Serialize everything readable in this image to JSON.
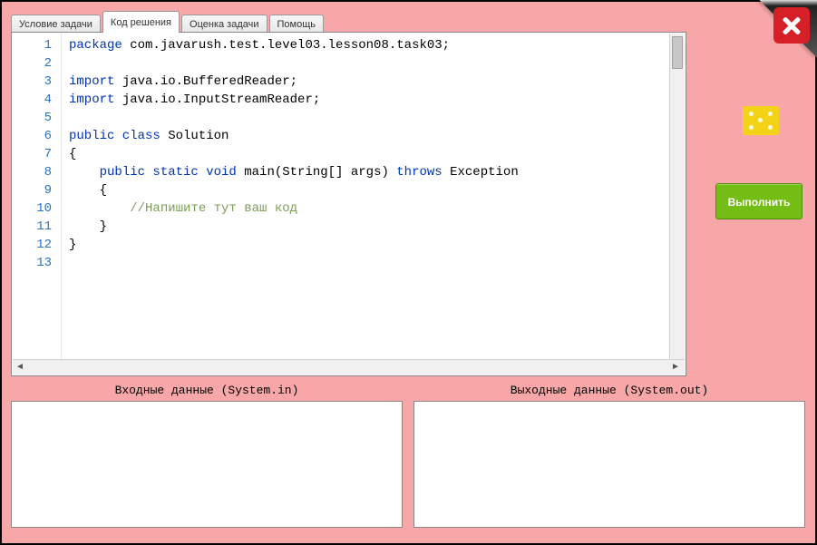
{
  "tabs": {
    "items": [
      {
        "label": "Условие задачи"
      },
      {
        "label": "Код решения"
      },
      {
        "label": "Оценка задачи"
      },
      {
        "label": "Помощь"
      }
    ],
    "active_index": 1
  },
  "editor": {
    "line_count": 13,
    "lines": {
      "l1_kw": "package",
      "l1_rest": " com.javarush.test.level03.lesson08.task03;",
      "l2": "",
      "l3_kw": "import",
      "l3_rest": " java.io.BufferedReader;",
      "l4_kw": "import",
      "l4_rest": " java.io.InputStreamReader;",
      "l5": "",
      "l6_kw": "public class",
      "l6_rest": " Solution",
      "l7": "{",
      "l8_pad": "    ",
      "l8_kw": "public static void",
      "l8_mid": " main(String[] args) ",
      "l8_kw2": "throws",
      "l8_rest": " Exception",
      "l9": "    {",
      "l10_pad": "        ",
      "l10_comment": "//Напишите тут ваш код",
      "l11": "    }",
      "l12": "}",
      "l13": ""
    }
  },
  "io": {
    "input_label": "Входные данные (System.in)",
    "output_label": "Выходные данные (System.out)",
    "input_value": "",
    "output_value": ""
  },
  "actions": {
    "run_label": "Выполнить"
  },
  "colors": {
    "background": "#f7a7a7",
    "run_button": "#73bd14",
    "close": "#d71f27"
  }
}
